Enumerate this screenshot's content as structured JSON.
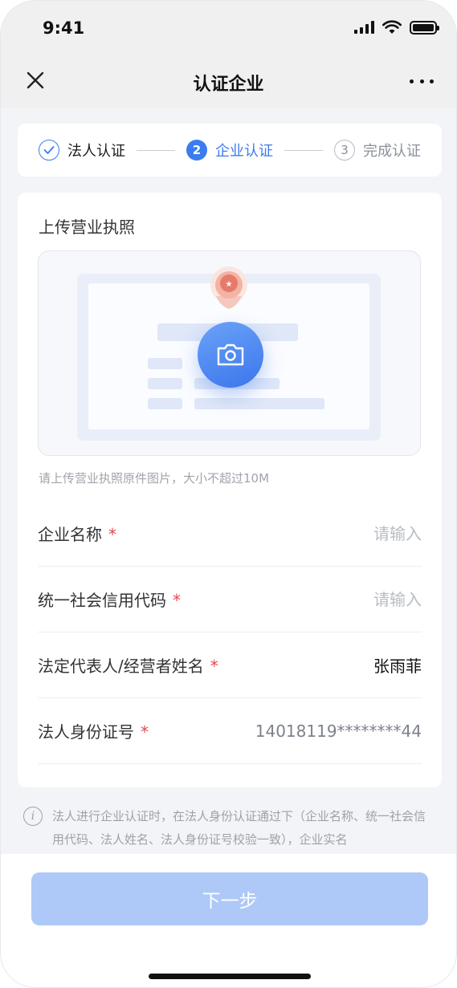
{
  "status_bar": {
    "time": "9:41"
  },
  "nav": {
    "title": "认证企业"
  },
  "steps": [
    {
      "label": "法人认证",
      "num": "",
      "state": "done"
    },
    {
      "label": "企业认证",
      "num": "2",
      "state": "active"
    },
    {
      "label": "完成认证",
      "num": "3",
      "state": "todo"
    }
  ],
  "upload": {
    "section_title": "上传营业执照",
    "hint": "请上传营业执照原件图片，大小不超过10M"
  },
  "fields": {
    "company_name": {
      "label": "企业名称",
      "required_mark": "*",
      "placeholder": "请输入"
    },
    "credit_code": {
      "label": "统一社会信用代码",
      "required_mark": "*",
      "placeholder": "请输入"
    },
    "legal_rep_name": {
      "label": "法定代表人/经营者姓名",
      "required_mark": "*",
      "value": "张雨菲"
    },
    "legal_id": {
      "label": "法人身份证号",
      "required_mark": "*",
      "value": "14018119********44"
    }
  },
  "notice": {
    "icon": "info-icon",
    "text": "法人进行企业认证时，在法人身份认证通过下（企业名称、统一社会信用代码、法人姓名、法人身份证号校验一致），企业实名"
  },
  "footer": {
    "next_label": "下一步"
  },
  "colors": {
    "accent": "#3b7cf0",
    "button_disabled": "#aec9f8",
    "required": "#e5484d"
  }
}
